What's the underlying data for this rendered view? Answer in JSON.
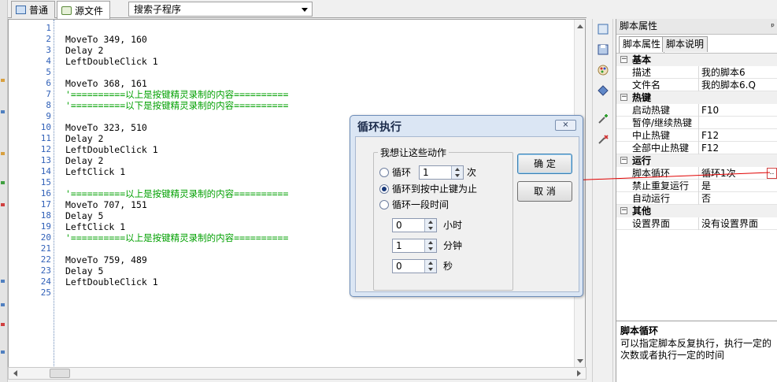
{
  "tabs": [
    {
      "label": "普通"
    },
    {
      "label": "源文件"
    }
  ],
  "subroutine_dropdown": {
    "value": "搜索子程序"
  },
  "editor": {
    "lines": [
      {
        "num": "1",
        "text": "",
        "type": "code"
      },
      {
        "num": "2",
        "text": "MoveTo 349, 160",
        "type": "code"
      },
      {
        "num": "3",
        "text": "Delay 2",
        "type": "code"
      },
      {
        "num": "4",
        "text": "LeftDoubleClick 1",
        "type": "code"
      },
      {
        "num": "5",
        "text": "",
        "type": "code"
      },
      {
        "num": "6",
        "text": "MoveTo 368, 161",
        "type": "code"
      },
      {
        "num": "7",
        "text": "'==========以上是按键精灵录制的内容==========",
        "type": "comment"
      },
      {
        "num": "8",
        "text": "'==========以下是按键精灵录制的内容==========",
        "type": "comment"
      },
      {
        "num": "9",
        "text": "",
        "type": "code"
      },
      {
        "num": "10",
        "text": "MoveTo 323, 510",
        "type": "code"
      },
      {
        "num": "11",
        "text": "Delay 2",
        "type": "code"
      },
      {
        "num": "12",
        "text": "LeftDoubleClick 1",
        "type": "code"
      },
      {
        "num": "13",
        "text": "Delay 2",
        "type": "code"
      },
      {
        "num": "14",
        "text": "LeftClick 1",
        "type": "code"
      },
      {
        "num": "15",
        "text": "",
        "type": "code"
      },
      {
        "num": "16",
        "text": "'==========以上是按键精灵录制的内容==========",
        "type": "comment"
      },
      {
        "num": "17",
        "text": "MoveTo 707, 151",
        "type": "code"
      },
      {
        "num": "18",
        "text": "Delay 5",
        "type": "code"
      },
      {
        "num": "19",
        "text": "LeftClick 1",
        "type": "code"
      },
      {
        "num": "20",
        "text": "'==========以上是按键精灵录制的内容==========",
        "type": "comment"
      },
      {
        "num": "21",
        "text": "",
        "type": "code"
      },
      {
        "num": "22",
        "text": "MoveTo 759, 489",
        "type": "code"
      },
      {
        "num": "23",
        "text": "Delay 5",
        "type": "code"
      },
      {
        "num": "24",
        "text": "LeftDoubleClick 1",
        "type": "code"
      },
      {
        "num": "25",
        "text": "",
        "type": "code"
      }
    ]
  },
  "properties": {
    "title": "脚本属性",
    "pin": "ᵖ",
    "tabs": [
      {
        "label": "脚本属性"
      },
      {
        "label": "脚本说明"
      }
    ],
    "rows": [
      {
        "kind": "cat",
        "toggle": "−",
        "key": "基本",
        "value": ""
      },
      {
        "kind": "item",
        "key": "描述",
        "value": "我的脚本6"
      },
      {
        "kind": "item",
        "key": "文件名",
        "value": "我的脚本6.Q"
      },
      {
        "kind": "cat",
        "toggle": "−",
        "key": "热键",
        "value": ""
      },
      {
        "kind": "item",
        "key": "启动热键",
        "value": "F10"
      },
      {
        "kind": "item",
        "key": "暂停/继续热键",
        "value": ""
      },
      {
        "kind": "item",
        "key": "中止热键",
        "value": "F12"
      },
      {
        "kind": "item",
        "key": "全部中止热键",
        "value": "F12"
      },
      {
        "kind": "cat",
        "toggle": "−",
        "key": "运行",
        "value": ""
      },
      {
        "kind": "item",
        "key": "脚本循环",
        "value": "循环1次"
      },
      {
        "kind": "item",
        "key": "禁止重复运行",
        "value": "是"
      },
      {
        "kind": "item",
        "key": "自动运行",
        "value": "否"
      },
      {
        "kind": "cat",
        "toggle": "−",
        "key": "其他",
        "value": ""
      },
      {
        "kind": "item",
        "key": "设置界面",
        "value": "没有设置界面"
      }
    ],
    "ellipsis": "..",
    "description": {
      "title": "脚本循环",
      "text": "可以指定脚本反复执行，执行一定的次数或者执行一定的时间"
    }
  },
  "dialog": {
    "title": "循环执行",
    "close": "⨯",
    "group_label": "我想让这些动作",
    "options": [
      {
        "label": "循环",
        "selected": false
      },
      {
        "label": "循环到按中止键为止",
        "selected": true
      },
      {
        "label": "循环一段时间",
        "selected": false
      }
    ],
    "loop_count": "1",
    "loop_unit": "次",
    "hours": "0",
    "hours_unit": "小时",
    "minutes": "1",
    "minutes_unit": "分钟",
    "seconds": "0",
    "seconds_unit": "秒",
    "ok_label": "确 定",
    "cancel_label": "取 消"
  },
  "toolbar_icons": [
    "script-icon",
    "save-icon",
    "palette-icon",
    "gear-icon",
    "add-tool-icon",
    "remove-tool-icon"
  ],
  "colors": {
    "comment": "#00a000",
    "line_number": "#3060b8",
    "annotation": "#e00000"
  }
}
